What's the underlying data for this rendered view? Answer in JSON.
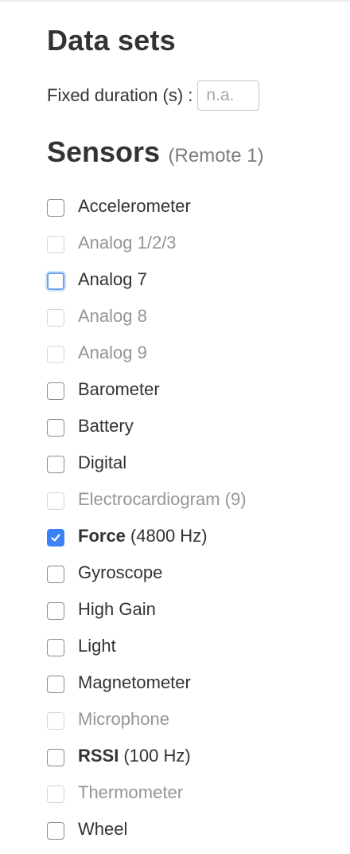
{
  "datasets": {
    "title": "Data sets",
    "fixed_duration_label": "Fixed duration (s) :",
    "fixed_duration_placeholder": "n.a."
  },
  "sensors": {
    "title": "Sensors",
    "subtitle": "(Remote 1)",
    "items": [
      {
        "name": "Accelerometer",
        "rate": "",
        "checked": false,
        "disabled": false,
        "focused": false
      },
      {
        "name": "Analog 1/2/3",
        "rate": "",
        "checked": false,
        "disabled": true,
        "focused": false
      },
      {
        "name": "Analog 7",
        "rate": "",
        "checked": false,
        "disabled": false,
        "focused": true
      },
      {
        "name": "Analog 8",
        "rate": "",
        "checked": false,
        "disabled": true,
        "focused": false
      },
      {
        "name": "Analog 9",
        "rate": "",
        "checked": false,
        "disabled": true,
        "focused": false
      },
      {
        "name": "Barometer",
        "rate": "",
        "checked": false,
        "disabled": false,
        "focused": false
      },
      {
        "name": "Battery",
        "rate": "",
        "checked": false,
        "disabled": false,
        "focused": false
      },
      {
        "name": "Digital",
        "rate": "",
        "checked": false,
        "disabled": false,
        "focused": false
      },
      {
        "name": "Electrocardiogram (9)",
        "rate": "",
        "checked": false,
        "disabled": true,
        "focused": false
      },
      {
        "name": "Force",
        "rate": "(4800 Hz)",
        "checked": true,
        "disabled": false,
        "focused": false,
        "bold": true
      },
      {
        "name": "Gyroscope",
        "rate": "",
        "checked": false,
        "disabled": false,
        "focused": false
      },
      {
        "name": "High Gain",
        "rate": "",
        "checked": false,
        "disabled": false,
        "focused": false
      },
      {
        "name": "Light",
        "rate": "",
        "checked": false,
        "disabled": false,
        "focused": false
      },
      {
        "name": "Magnetometer",
        "rate": "",
        "checked": false,
        "disabled": false,
        "focused": false
      },
      {
        "name": "Microphone",
        "rate": "",
        "checked": false,
        "disabled": true,
        "focused": false
      },
      {
        "name": "RSSI",
        "rate": "(100 Hz)",
        "checked": false,
        "disabled": false,
        "focused": false,
        "bold": true
      },
      {
        "name": "Thermometer",
        "rate": "",
        "checked": false,
        "disabled": true,
        "focused": false
      },
      {
        "name": "Wheel",
        "rate": "",
        "checked": false,
        "disabled": false,
        "focused": false
      }
    ]
  },
  "colors": {
    "accent": "#3b82f6",
    "focus_ring": "#6aa3ee",
    "text": "#333333",
    "disabled_text": "#959595"
  }
}
